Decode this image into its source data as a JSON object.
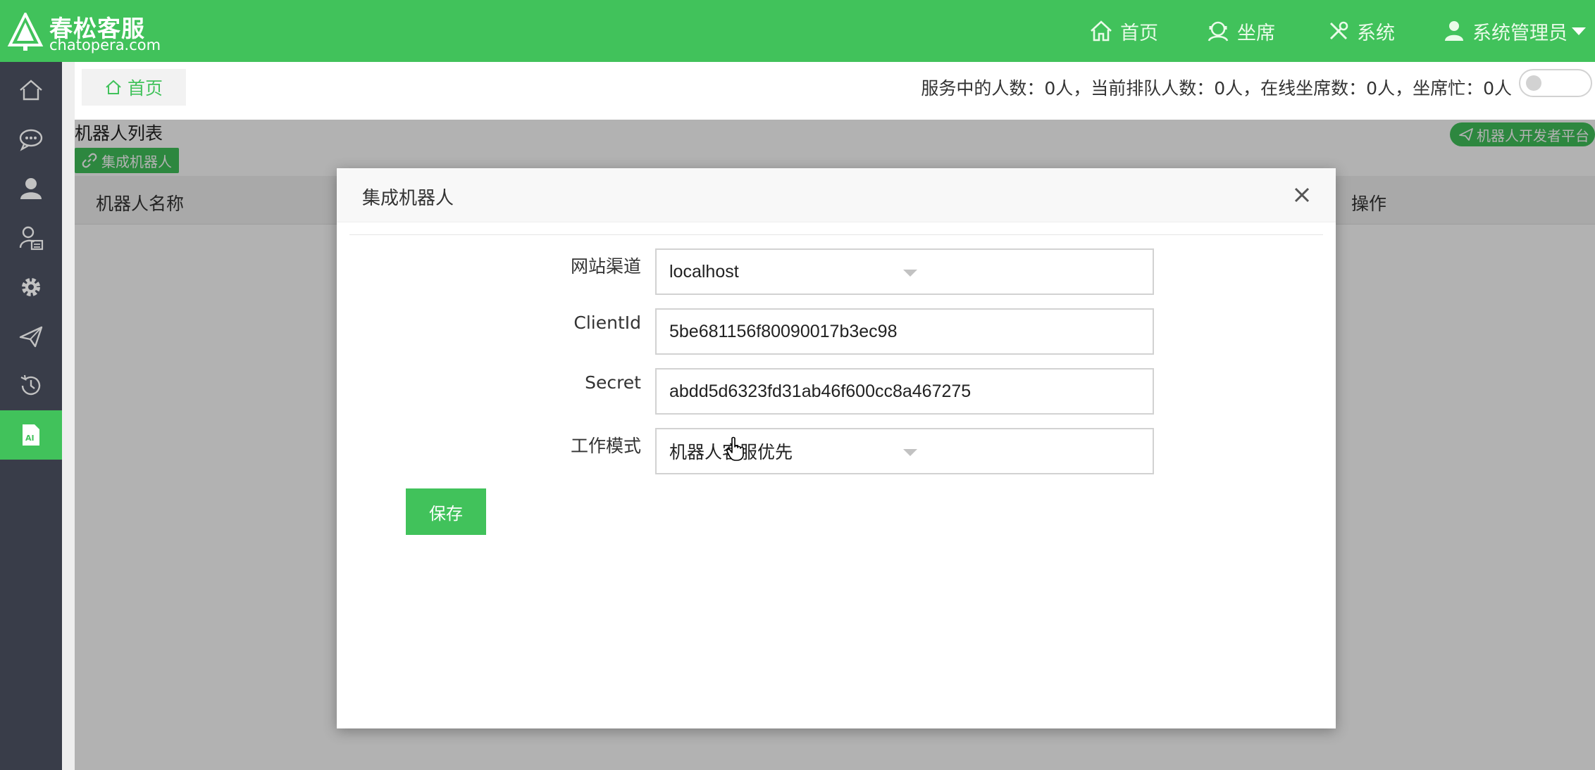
{
  "brand": {
    "title": "春松客服",
    "subtitle": "chatopera.com"
  },
  "top_nav": {
    "home": "首页",
    "agent": "坐席",
    "system": "系统",
    "user": "系统管理员"
  },
  "tabs": {
    "home": "首页"
  },
  "status": {
    "text": "服务中的人数：0人，当前排队人数：0人，在线坐席数：0人，坐席忙：0人",
    "toggle_on": false
  },
  "page": {
    "list_title": "机器人列表",
    "integrate_button": "集成机器人",
    "dev_platform_button": "机器人开发者平台",
    "table_headers": {
      "name": "机器人名称",
      "operations": "操作"
    }
  },
  "modal": {
    "title": "集成机器人",
    "fields": {
      "channel": {
        "label": "网站渠道",
        "value": "localhost"
      },
      "client_id": {
        "label": "ClientId",
        "value": "5be681156f80090017b3ec98"
      },
      "secret": {
        "label": "Secret",
        "value": "abdd5d6323fd31ab46f600cc8a467275"
      },
      "mode": {
        "label": "工作模式",
        "value": "机器人客服优先"
      }
    },
    "save_label": "保存"
  },
  "colors": {
    "brand_green": "#41c25b",
    "sidebar_bg": "#393d49"
  },
  "icons": {
    "sidebar": [
      "home-icon",
      "chat-icon",
      "user-icon",
      "contacts-icon",
      "gear-icon",
      "send-icon",
      "history-icon",
      "ai-doc-icon"
    ],
    "sidebar_active_index": 7
  }
}
